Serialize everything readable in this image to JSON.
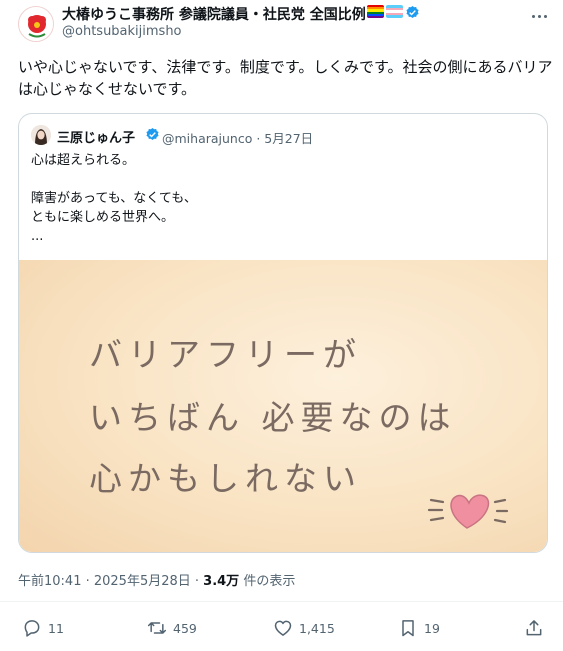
{
  "header": {
    "name": "大椿ゆうこ事務所 参議院議員・社民党 全国比例",
    "handle": "@ohtsubakijimsho"
  },
  "post": {
    "text": "いや心じゃないです、法律です。制度です。しくみです。社会の側にあるバリアは心じゃなくせないです。"
  },
  "quote": {
    "name": "三原じゅん子",
    "handle_date": "@miharajunco · 5月27日",
    "lines": [
      "心は超えられる。",
      "",
      "障害があっても、なくても、",
      "ともに楽しめる世界へ。",
      "..."
    ],
    "image_text": {
      "line1": "バリアフリーが",
      "line2": "いちばん 必要なのは",
      "line3": "心かもしれない"
    }
  },
  "meta": {
    "time": "午前10:41 · 2025年5月28日 · ",
    "views": "3.4万",
    "views_suffix": " 件の表示"
  },
  "actions": {
    "replies": "11",
    "reposts": "459",
    "likes": "1,415",
    "bookmarks": "19"
  },
  "colors": {
    "text": "#0f1419",
    "secondary": "#536471",
    "verified": "#1d9bf0",
    "heart": "#f08fa0"
  }
}
